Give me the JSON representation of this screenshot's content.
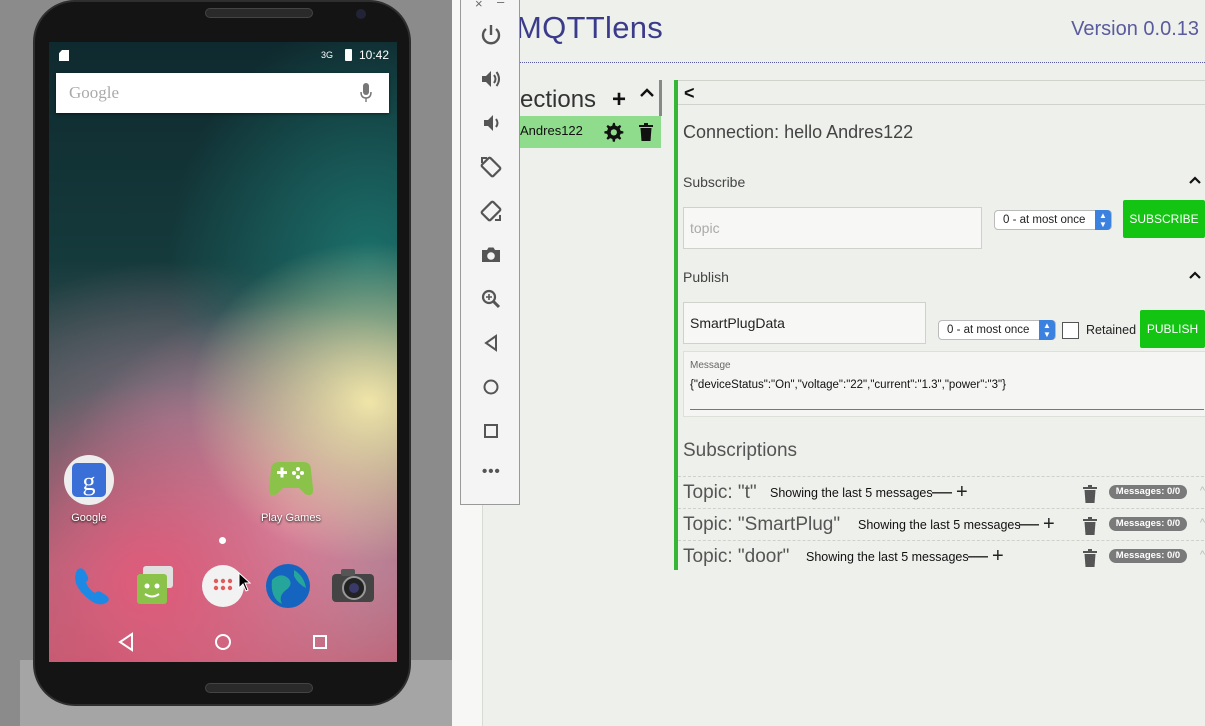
{
  "mqtt": {
    "title": "MQTTlens",
    "version": "Version 0.0.13",
    "connections_heading": "ections",
    "add_symbol": "+",
    "collapse_symbol": "^",
    "connection_item": "Andres122",
    "back_symbol": "<",
    "connection_title": "Connection: hello Andres122",
    "subscribe": {
      "label": "Subscribe",
      "topic_placeholder": "topic",
      "qos": "0 - at most once",
      "button": "SUBSCRIBE"
    },
    "publish": {
      "label": "Publish",
      "topic_value": "SmartPlugData",
      "qos": "0 - at most once",
      "retained_label": "Retained",
      "retained_checked": false,
      "button": "PUBLISH",
      "message_label": "Message",
      "message_value": "{\"deviceStatus\":\"On\",\"voltage\":\"22\",\"current\":\"1.3\",\"power\":\"3\"}"
    },
    "subscriptions_heading": "Subscriptions",
    "subscriptions": [
      {
        "topic": "Topic: \"t\"",
        "showing": "Showing the last 5 messages",
        "badge": "Messages: 0/0"
      },
      {
        "topic": "Topic: \"SmartPlug\"",
        "showing": "Showing the last 5 messages",
        "badge": "Messages: 0/0"
      },
      {
        "topic": "Topic: \"door\"",
        "showing": "Showing the last 5 messages",
        "badge": "Messages: 0/0"
      }
    ],
    "accent_color": "#13c413",
    "title_color": "#3b3b8c"
  },
  "emulator_toolbar": {
    "close_symbol": "×",
    "minimize_symbol": "–",
    "more_symbol": "•••",
    "buttons": [
      "power-icon",
      "volume-up-icon",
      "volume-down-icon",
      "rotate-left-icon",
      "rotate-right-icon",
      "camera-icon",
      "zoom-icon",
      "back-icon",
      "home-icon",
      "overview-icon"
    ]
  },
  "android": {
    "status": {
      "signal": "3G",
      "time": "10:42"
    },
    "search_placeholder": "Google",
    "home_apps": [
      {
        "label": "Google",
        "icon": "google-app-icon"
      },
      {
        "label": "Play Games",
        "icon": "play-games-icon"
      }
    ],
    "dock": [
      "phone-icon",
      "messenger-icon",
      "app-drawer-icon",
      "browser-icon",
      "camera-app-icon"
    ]
  }
}
